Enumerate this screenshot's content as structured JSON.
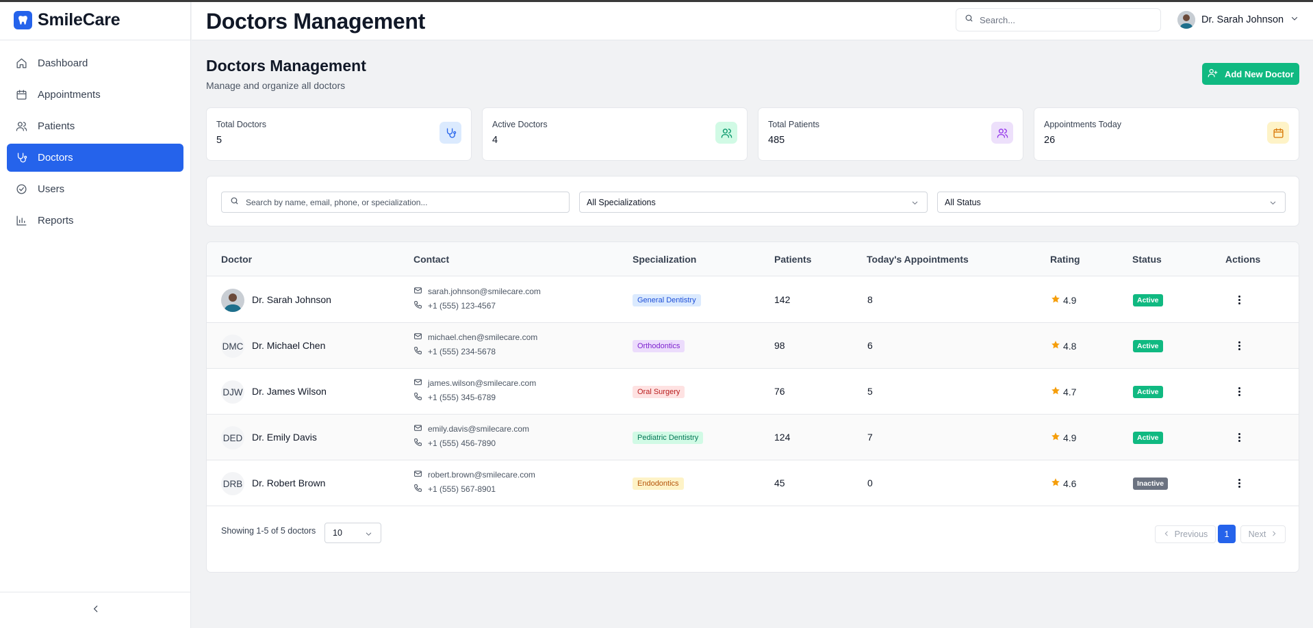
{
  "app": {
    "brand": "SmileCare"
  },
  "header": {
    "title": "Doctors Management",
    "search_placeholder": "Search...",
    "user_name": "Dr. Sarah Johnson"
  },
  "sidebar": {
    "items": [
      {
        "label": "Dashboard",
        "icon": "home-icon",
        "active": false
      },
      {
        "label": "Appointments",
        "icon": "calendar-icon",
        "active": false
      },
      {
        "label": "Patients",
        "icon": "users-icon",
        "active": false
      },
      {
        "label": "Doctors",
        "icon": "stethoscope-icon",
        "active": true
      },
      {
        "label": "Users",
        "icon": "check-circle-icon",
        "active": false
      },
      {
        "label": "Reports",
        "icon": "bar-chart-icon",
        "active": false
      }
    ]
  },
  "page": {
    "title": "Doctors Management",
    "subtitle": "Manage and organize all doctors",
    "add_button": "Add New Doctor"
  },
  "stats": [
    {
      "label": "Total Doctors",
      "value": "5",
      "icon": "stethoscope-icon",
      "color": "#2563eb",
      "bg": "#dbeafe"
    },
    {
      "label": "Active Doctors",
      "value": "4",
      "icon": "users-icon",
      "color": "#059669",
      "bg": "#d1fae5"
    },
    {
      "label": "Total Patients",
      "value": "485",
      "icon": "users-icon",
      "color": "#9333ea",
      "bg": "#ede0fb"
    },
    {
      "label": "Appointments Today",
      "value": "26",
      "icon": "calendar-icon",
      "color": "#d97706",
      "bg": "#fef3c7"
    }
  ],
  "filters": {
    "search_placeholder": "Search by name, email, phone, or specialization...",
    "specialization": "All Specializations",
    "status": "All Status"
  },
  "table": {
    "columns": [
      "Doctor",
      "Contact",
      "Specialization",
      "Patients",
      "Today's Appointments",
      "Rating",
      "Status",
      "Actions"
    ],
    "rows": [
      {
        "initials": "",
        "name": "Dr. Sarah Johnson",
        "email": "sarah.johnson@smilecare.com",
        "phone": "+1 (555) 123-4567",
        "specialization": "General Dentistry",
        "spec_color": "#1d4ed8",
        "spec_bg": "#dbeafe",
        "patients": "142",
        "today": "8",
        "rating": "4.9",
        "status": "Active",
        "status_color": "#10b981"
      },
      {
        "initials": "DMC",
        "name": "Dr. Michael Chen",
        "email": "michael.chen@smilecare.com",
        "phone": "+1 (555) 234-5678",
        "specialization": "Orthodontics",
        "spec_color": "#7e22ce",
        "spec_bg": "#ecdcfc",
        "patients": "98",
        "today": "6",
        "rating": "4.8",
        "status": "Active",
        "status_color": "#10b981"
      },
      {
        "initials": "DJW",
        "name": "Dr. James Wilson",
        "email": "james.wilson@smilecare.com",
        "phone": "+1 (555) 345-6789",
        "specialization": "Oral Surgery",
        "spec_color": "#b91c1c",
        "spec_bg": "#fee2e2",
        "patients": "76",
        "today": "5",
        "rating": "4.7",
        "status": "Active",
        "status_color": "#10b981"
      },
      {
        "initials": "DED",
        "name": "Dr. Emily Davis",
        "email": "emily.davis@smilecare.com",
        "phone": "+1 (555) 456-7890",
        "specialization": "Pediatric Dentistry",
        "spec_color": "#047857",
        "spec_bg": "#d1fae5",
        "patients": "124",
        "today": "7",
        "rating": "4.9",
        "status": "Active",
        "status_color": "#10b981"
      },
      {
        "initials": "DRB",
        "name": "Dr. Robert Brown",
        "email": "robert.brown@smilecare.com",
        "phone": "+1 (555) 567-8901",
        "specialization": "Endodontics",
        "spec_color": "#b45309",
        "spec_bg": "#fef3c7",
        "patients": "45",
        "today": "0",
        "rating": "4.6",
        "status": "Inactive",
        "status_color": "#6b7280"
      }
    ]
  },
  "pagination": {
    "showing": "Showing 1-5 of 5 doctors",
    "per_page": "10",
    "previous": "Previous",
    "page": "1",
    "next": "Next"
  }
}
